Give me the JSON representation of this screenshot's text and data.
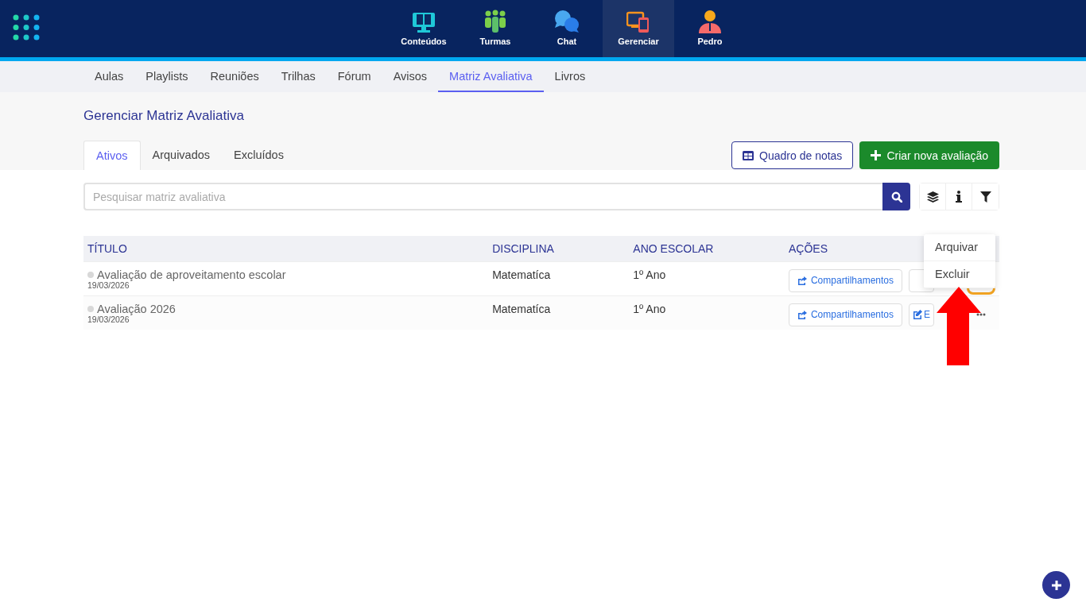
{
  "top_nav": {
    "items": [
      {
        "label": "Conteúdos",
        "kind": "screen",
        "selected": false
      },
      {
        "label": "Turmas",
        "kind": "people",
        "selected": false
      },
      {
        "label": "Chat",
        "kind": "chat",
        "selected": false
      },
      {
        "label": "Gerenciar",
        "kind": "devices",
        "selected": true
      },
      {
        "label": "Pedro",
        "kind": "person",
        "selected": false
      }
    ]
  },
  "sub_nav": {
    "items": [
      {
        "label": "Aulas",
        "selected": false
      },
      {
        "label": "Playlists",
        "selected": false
      },
      {
        "label": "Reuniões",
        "selected": false
      },
      {
        "label": "Trilhas",
        "selected": false
      },
      {
        "label": "Fórum",
        "selected": false
      },
      {
        "label": "Avisos",
        "selected": false
      },
      {
        "label": "Matriz Avaliativa",
        "selected": true
      },
      {
        "label": "Livros",
        "selected": false
      }
    ]
  },
  "page": {
    "title": "Gerenciar Matriz Avaliativa"
  },
  "tabs": [
    {
      "label": "Ativos",
      "selected": true
    },
    {
      "label": "Arquivados",
      "selected": false
    },
    {
      "label": "Excluídos",
      "selected": false
    }
  ],
  "buttons": {
    "grades": "Quadro de notas",
    "create": "Criar nova avaliação"
  },
  "search": {
    "placeholder": "Pesquisar matriz avaliativa"
  },
  "table": {
    "columns": [
      "TÍTULO",
      "DISCIPLINA",
      "ANO ESCOLAR",
      "AÇÕES"
    ],
    "rows": [
      {
        "title": "Avaliação de aproveitamento escolar",
        "date": "19/03/2026",
        "discipline": "Matematíca",
        "year": "1º Ano",
        "share": "Compartilhamentos",
        "focused": true
      },
      {
        "title": "Avaliação 2026",
        "date": "19/03/2026",
        "discipline": "Matematíca",
        "year": "1º Ano",
        "share": "Compartilhamentos",
        "edit": "E",
        "focused": false
      }
    ]
  },
  "menu": {
    "items": [
      "Arquivar",
      "Excluir"
    ]
  }
}
